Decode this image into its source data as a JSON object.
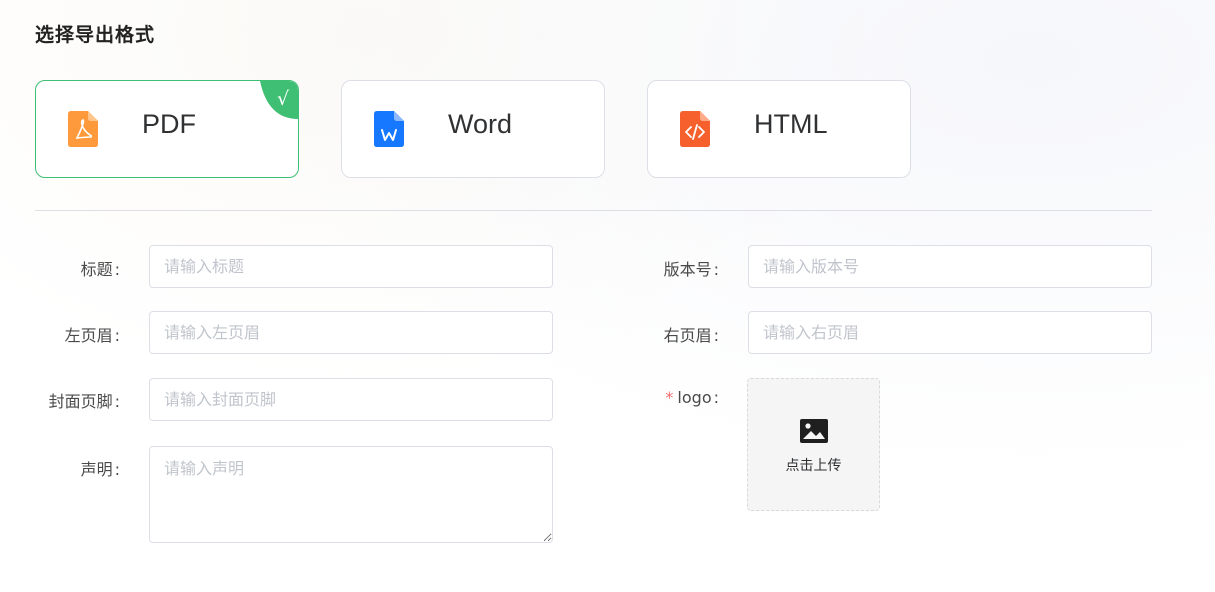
{
  "section": {
    "title": "选择导出格式"
  },
  "formats": [
    {
      "label": "PDF",
      "icon": "pdf-file-icon",
      "color": "#ff9a3c",
      "selected": true
    },
    {
      "label": "Word",
      "icon": "word-file-icon",
      "color": "#1677ff",
      "selected": false
    },
    {
      "label": "HTML",
      "icon": "html-file-icon",
      "color": "#f5602c",
      "selected": false
    }
  ],
  "check_mark": "√",
  "colors": {
    "selected_border": "#3fbf74",
    "check_bg": "#3fbf74",
    "required": "#f56c6c",
    "border": "#dcdfe6",
    "placeholder": "#c0c4cc"
  },
  "form": {
    "title": {
      "label": "标题",
      "placeholder": "请输入标题",
      "value": ""
    },
    "version": {
      "label": "版本号",
      "placeholder": "请输入版本号",
      "value": ""
    },
    "left_header": {
      "label": "左页眉",
      "placeholder": "请输入左页眉",
      "value": ""
    },
    "right_header": {
      "label": "右页眉",
      "placeholder": "请输入右页眉",
      "value": ""
    },
    "cover_footer": {
      "label": "封面页脚",
      "placeholder": "请输入封面页脚",
      "value": ""
    },
    "statement": {
      "label": "声明",
      "placeholder": "请输入声明",
      "value": ""
    },
    "logo": {
      "label": "logo",
      "required_mark": "*",
      "upload_text": "点击上传",
      "icon": "image-icon"
    },
    "colon": ":"
  }
}
